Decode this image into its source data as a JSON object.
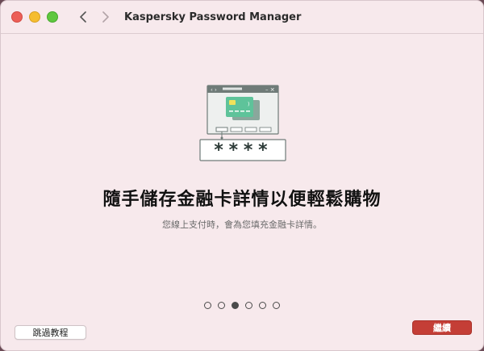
{
  "window": {
    "title": "Kaspersky Password Manager"
  },
  "nav": {
    "back_icon": "chevron-left-icon",
    "forward_icon": "chevron-right-icon"
  },
  "illustration": {
    "masked_password": "****"
  },
  "onboarding": {
    "heading": "隨手儲存金融卡詳情以便輕鬆購物",
    "subtitle": "您線上支付時，會為您填充金融卡詳情。",
    "pager": {
      "total": 6,
      "active_index": 2
    }
  },
  "buttons": {
    "skip_label": "跳過教程",
    "continue_label": "繼續"
  },
  "colors": {
    "background": "#f7e9ec",
    "accent": "#c43e36",
    "illustration_teal": "#5ec39a",
    "illustration_gray": "#6f7b78"
  }
}
